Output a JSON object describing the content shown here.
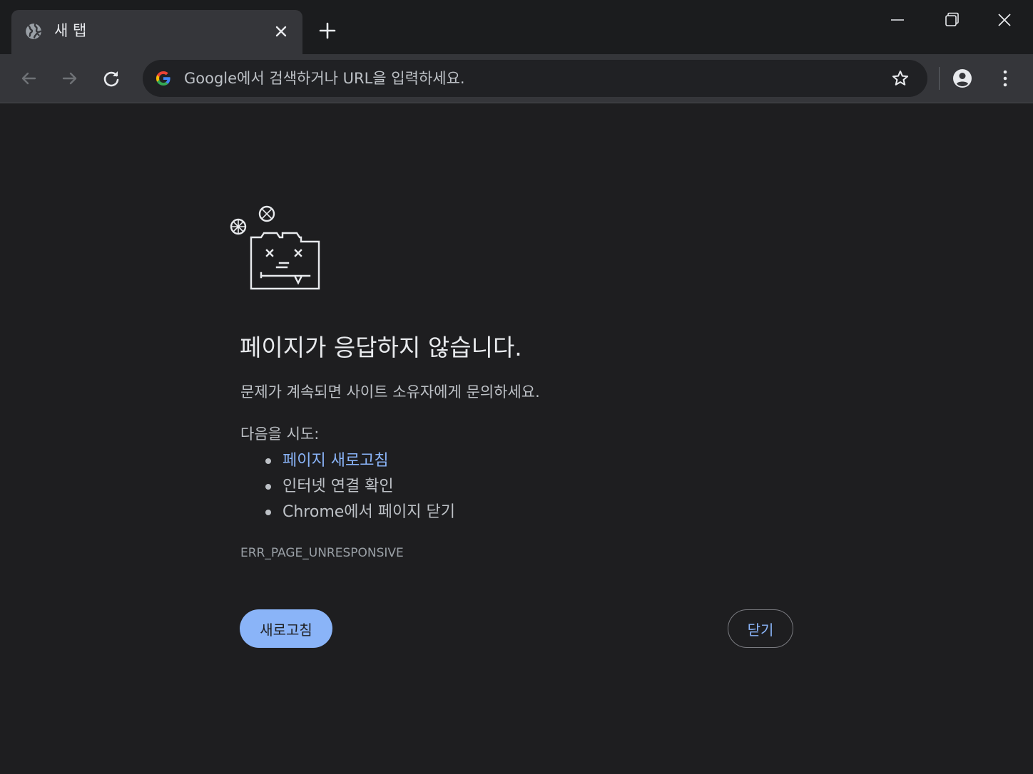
{
  "tab": {
    "title": "새 탭",
    "icon": "globe-icon",
    "close_icon": "close-icon"
  },
  "newtab_icon": "plus-icon",
  "window_controls": {
    "minimize_icon": "minimize-icon",
    "restore_icon": "restore-icon",
    "close_icon": "close-icon"
  },
  "toolbar": {
    "back_icon": "arrow-left-icon",
    "forward_icon": "arrow-right-icon",
    "reload_icon": "reload-icon",
    "omnibox_placeholder": "Google에서 검색하거나 URL을 입력하세요.",
    "omnibox_icon": "google-logo-icon",
    "bookmark_icon": "star-icon",
    "profile_icon": "account-icon",
    "menu_icon": "more-vert-icon"
  },
  "error": {
    "icon": "unresponsive-page-icon",
    "title": "페이지가 응답하지 않습니다.",
    "description": "문제가 계속되면 사이트 소유자에게 문의하세요.",
    "try_label": "다음을 시도:",
    "suggestions": {
      "reload_link": "페이지 새로고침",
      "check_connection": "인터넷 연결 확인",
      "close_page": "Chrome에서 페이지 닫기"
    },
    "code": "ERR_PAGE_UNRESPONSIVE",
    "reload_button": "새로고침",
    "close_button": "닫기"
  },
  "colors": {
    "background": "#1e1e20",
    "toolbar": "#35363a",
    "link": "#8ab4f8",
    "primary_button": "#8ab4f8"
  }
}
